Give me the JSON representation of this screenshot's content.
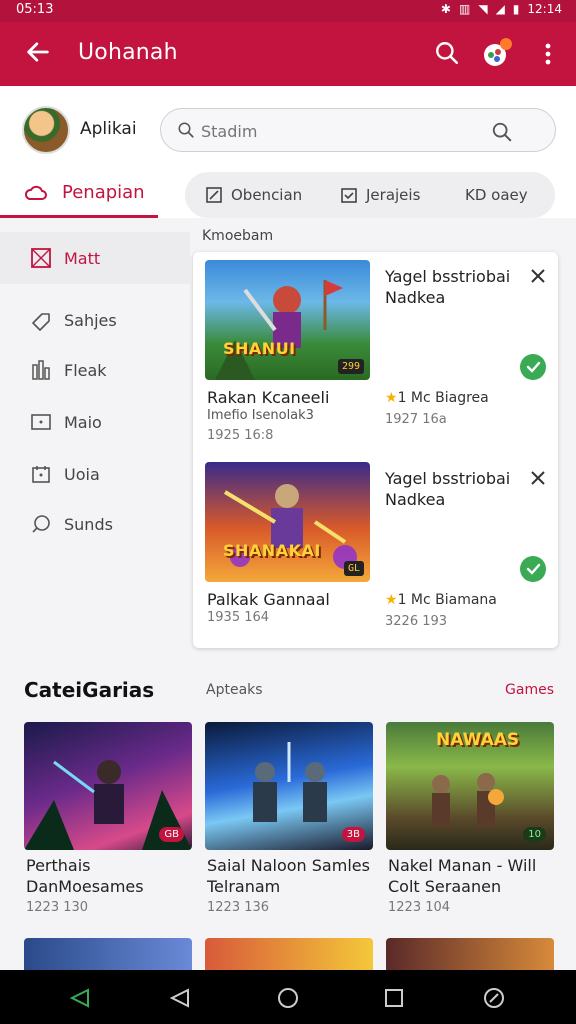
{
  "status_bar": {
    "time": "05:13",
    "right": "12:14",
    "icons": [
      "bluetooth-icon",
      "nfc-icon",
      "wifi-icon",
      "signal-icon",
      "battery-icon"
    ]
  },
  "app_bar": {
    "title": "Uohanah",
    "color": "#c2143f"
  },
  "profile": {
    "name": "Aplikai"
  },
  "search": {
    "placeholder": "Stadim"
  },
  "tabs": {
    "main": "Penapian",
    "pills": [
      "Obencian",
      "Jerajeis",
      "KD oaey"
    ]
  },
  "sidebar": {
    "items": [
      {
        "label": "Matt",
        "icon": "box-icon",
        "active": true
      },
      {
        "label": "Sahjes",
        "icon": "tag-icon"
      },
      {
        "label": "Fleak",
        "icon": "bars-icon"
      },
      {
        "label": "Maio",
        "icon": "mail-icon"
      },
      {
        "label": "Uoia",
        "icon": "calendar-icon"
      },
      {
        "label": "Sunds",
        "icon": "chat-icon"
      }
    ]
  },
  "section_label": "Kmoebam",
  "cards": [
    {
      "thumb_title": "SHANUI",
      "thumb_badge": "299",
      "name": "Rakan Kcaneeli",
      "sub": "Imefio Isenolak3",
      "meta": "1925 16:8",
      "head": "Yagel bsstriobai Nadkea",
      "rating": "1 Mc Biagrea",
      "meta2": "1927 16a"
    },
    {
      "thumb_title": "SHANAKAI",
      "thumb_badge": "GL",
      "name": "Palkak Gannaal",
      "sub": "",
      "meta": "1935 164",
      "head": "Yagel bsstriobai Nadkea",
      "rating": "1 Mc Biamana",
      "meta2": "3226 193"
    }
  ],
  "categories": {
    "title": "CateiGarias",
    "middle": "Apteaks",
    "link": "Games",
    "tiles": [
      {
        "line1": "Perthais",
        "line2": "DanMoesames",
        "meta": "1223 130",
        "badge": "GB",
        "img_title": ""
      },
      {
        "line1": "Saial Naloon Samles",
        "line2": "Telranam",
        "meta": "1223 136",
        "badge": "3B",
        "img_title": ""
      },
      {
        "line1": "Nakel Manan  - Will",
        "line2": "Colt Seraanen",
        "meta": "1223 104",
        "badge": "10",
        "img_title": "NAWAAS"
      }
    ]
  }
}
